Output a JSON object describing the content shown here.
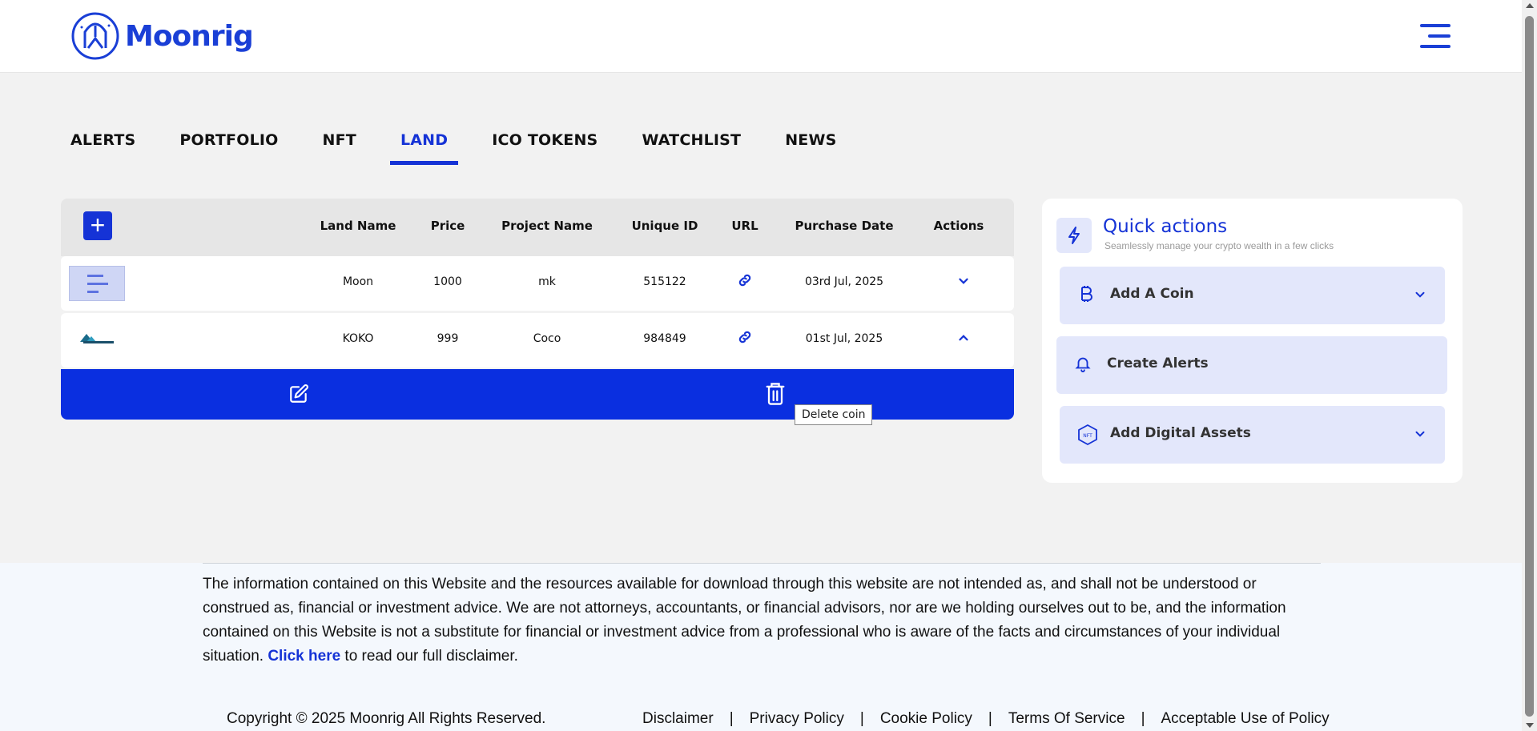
{
  "brand": {
    "name": "Moonrig",
    "accent": "#1533d6"
  },
  "tabs": [
    {
      "label": "ALERTS"
    },
    {
      "label": "PORTFOLIO"
    },
    {
      "label": "NFT"
    },
    {
      "label": "LAND",
      "active": true
    },
    {
      "label": "ICO TOKENS"
    },
    {
      "label": "WATCHLIST"
    },
    {
      "label": "NEWS"
    }
  ],
  "table": {
    "headers": [
      "Land Name",
      "Price",
      "Project Name",
      "Unique ID",
      "URL",
      "Purchase Date",
      "Actions"
    ],
    "rows": [
      {
        "land_name": "Moon",
        "price": "1000",
        "project_name": "mk",
        "unique_id": "515122",
        "purchase_date": "03rd Jul, 2025",
        "expanded": false
      },
      {
        "land_name": "KOKO",
        "price": "999",
        "project_name": "Coco",
        "unique_id": "984849",
        "purchase_date": "01st Jul, 2025",
        "expanded": true
      }
    ],
    "tooltip": "Delete coin"
  },
  "quick_actions": {
    "title": "Quick actions",
    "subtitle": "Seamlessly manage your crypto wealth in a few clicks",
    "items": [
      {
        "label": "Add A Coin",
        "icon": "bitcoin-icon"
      },
      {
        "label": "Create Alerts",
        "icon": "bell-icon"
      },
      {
        "label": "Add Digital Assets",
        "icon": "nft-icon"
      }
    ]
  },
  "footer": {
    "disclaimer": "The information contained on this Website and the resources available for download through this website are not intended as, and shall not be understood or construed as, financial or investment advice. We are not attorneys, accountants, or financial advisors, nor are we holding ourselves out to be, and the information contained on this Website is not a substitute for financial or investment advice from a professional who is aware of the facts and circumstances of your individual situation.",
    "disclaimer_link": "Click here",
    "disclaimer_tail": " to read our full disclaimer.",
    "copyright": "Copyright © 2025 Moonrig All Rights Reserved.",
    "links": [
      "Disclaimer",
      "Privacy Policy",
      "Cookie Policy",
      "Terms Of Service",
      "Acceptable Use of Policy"
    ],
    "separator": "|"
  }
}
